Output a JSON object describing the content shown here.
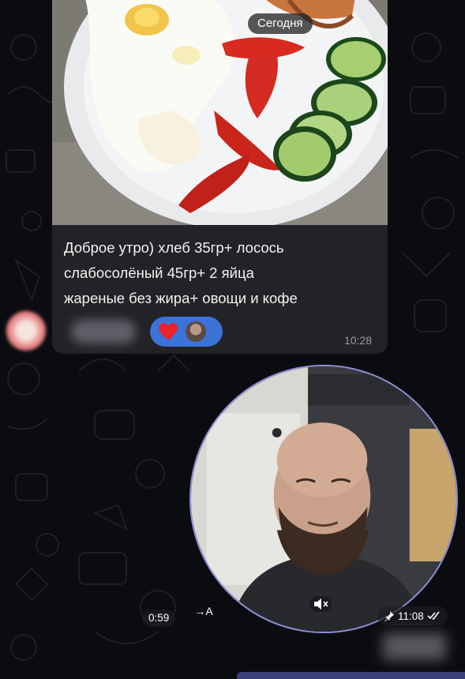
{
  "chat": {
    "date_separator": "Сегодня",
    "message": {
      "caption_lines": [
        "Доброе утро) хлеб 35гр+ лосось",
        "слабосолёный 45гр+ 2 яйца",
        "жареные без жира+ овощи и кофе"
      ],
      "time": "10:28",
      "reaction_icon": "heart-icon",
      "reaction_color": "#3b73d9"
    },
    "video_message": {
      "duration": "0:59",
      "transcribe_label": "→A",
      "time": "11:08",
      "pinned_icon": "pin-icon",
      "status_icon": "double-check-icon",
      "border_color": "#8f8fd8"
    }
  }
}
